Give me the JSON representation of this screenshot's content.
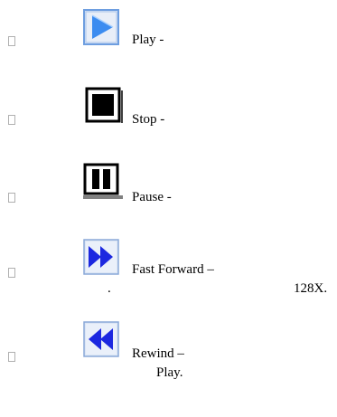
{
  "items": [
    {
      "label": "Play -",
      "icon": "play-icon"
    },
    {
      "label": "Stop -",
      "icon": "stop-icon"
    },
    {
      "label": "Pause -",
      "icon": "pause-icon"
    },
    {
      "label": "Fast Forward –",
      "icon": "fast-forward-icon",
      "continuation_dot": ".",
      "continuation_text": "128X."
    },
    {
      "label": "Rewind –",
      "icon": "rewind-icon",
      "continuation_text": "Play."
    }
  ],
  "colors": {
    "play_blue": "#3c8cf0",
    "icon_frame": "#6e9ee0",
    "rewind_blue": "#1c28e0",
    "black": "#000000"
  }
}
